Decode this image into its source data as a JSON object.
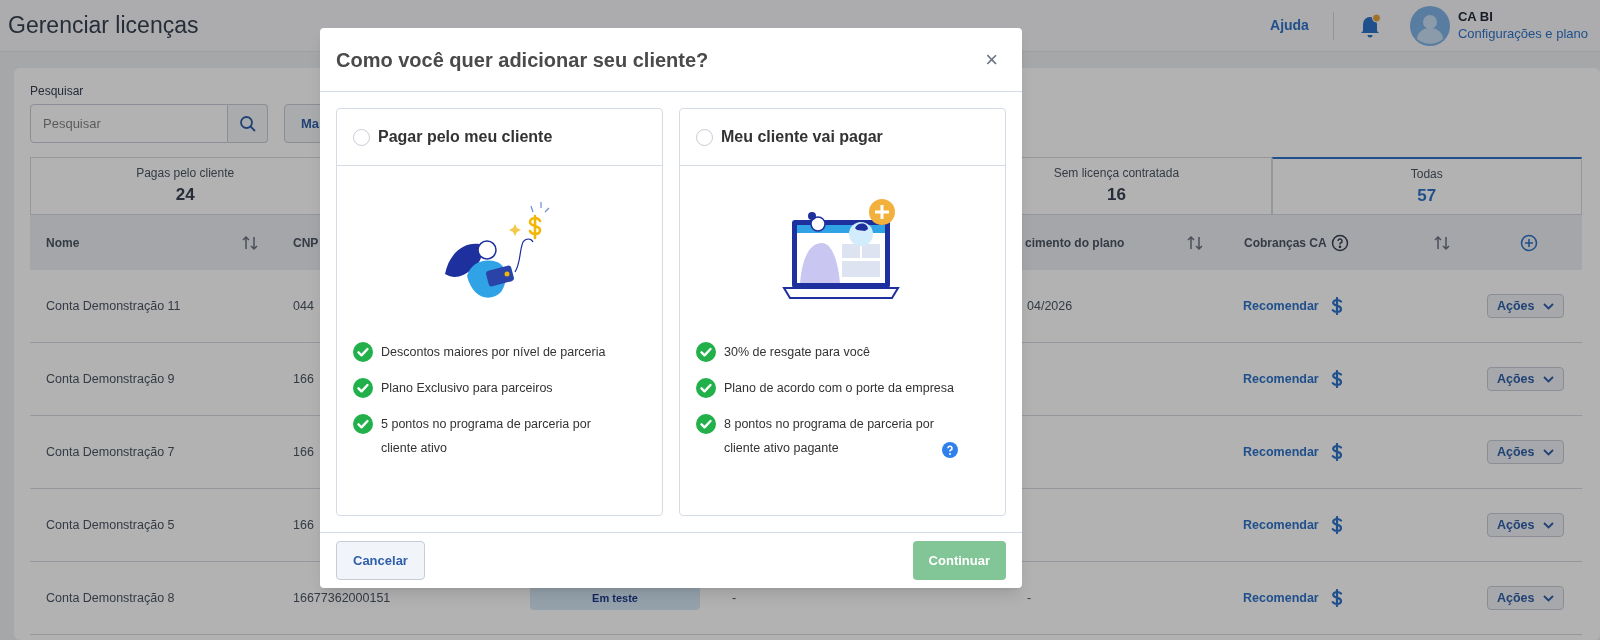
{
  "header": {
    "title": "Gerenciar licenças",
    "help_link": "Ajuda",
    "notification": {
      "unread": true
    },
    "user": {
      "name": "CA BI",
      "settings_link": "Configurações e plano"
    }
  },
  "toolbar": {
    "search_label": "Pesquisar",
    "search_placeholder": "Pesquisar",
    "button_fragment": "Ma"
  },
  "stat_tabs": [
    {
      "label": "Pagas pelo cliente",
      "count": "24",
      "selected": false
    },
    {
      "label": "Sem licença contratada",
      "count": "16",
      "selected": false
    },
    {
      "label": "Todas",
      "count": "57",
      "selected": true
    }
  ],
  "table": {
    "columns": [
      {
        "label": "Nome",
        "sortable": true,
        "help": false
      },
      {
        "label": "CNP"
      },
      {
        "label": "cimento do plano",
        "sortable": true,
        "help": false
      },
      {
        "label": "Cobranças CA",
        "sortable": true,
        "help": true
      }
    ],
    "rows": [
      {
        "name": "Conta Demonstração 11",
        "cnpj": "044",
        "plan_end": "04/2026",
        "recommend": "Recomendar",
        "actions": "Ações"
      },
      {
        "name": "Conta Demonstração 9",
        "cnpj": "166",
        "recommend": "Recomendar",
        "actions": "Ações"
      },
      {
        "name": "Conta Demonstração 7",
        "cnpj": "166",
        "recommend": "Recomendar",
        "actions": "Ações"
      },
      {
        "name": "Conta Demonstração 5",
        "cnpj": "166",
        "recommend": "Recomendar",
        "actions": "Ações"
      },
      {
        "name": "Conta Demonstração 8",
        "cnpj": "16677362000151",
        "status": "Em teste",
        "column_4": "-",
        "plan_end": "-",
        "recommend": "Recomendar",
        "actions": "Ações"
      }
    ]
  },
  "modal": {
    "title": "Como você quer adicionar seu cliente?",
    "close": "×",
    "options": [
      {
        "title": "Pagar pelo meu cliente",
        "selected": false,
        "kind": "card",
        "benefits": [
          {
            "text": "Descontos maiores por nível de parceria",
            "help": false
          },
          {
            "text": "Plano Exclusivo para parceiros",
            "help": false
          },
          {
            "text": "5 pontos no programa de parceria por cliente ativo",
            "help": false
          }
        ]
      },
      {
        "title": "Meu cliente vai pagar",
        "selected": false,
        "kind": "laptop",
        "benefits": [
          {
            "text": "30% de resgate para você",
            "help": false
          },
          {
            "text": "Plano de acordo com o porte da empresa",
            "help": false
          },
          {
            "text": "8 pontos no programa de parceria por cliente ativo pagante",
            "help": true
          }
        ]
      }
    ],
    "cancel": "Cancelar",
    "confirm": {
      "label": "Continuar",
      "disabled": true
    }
  }
}
